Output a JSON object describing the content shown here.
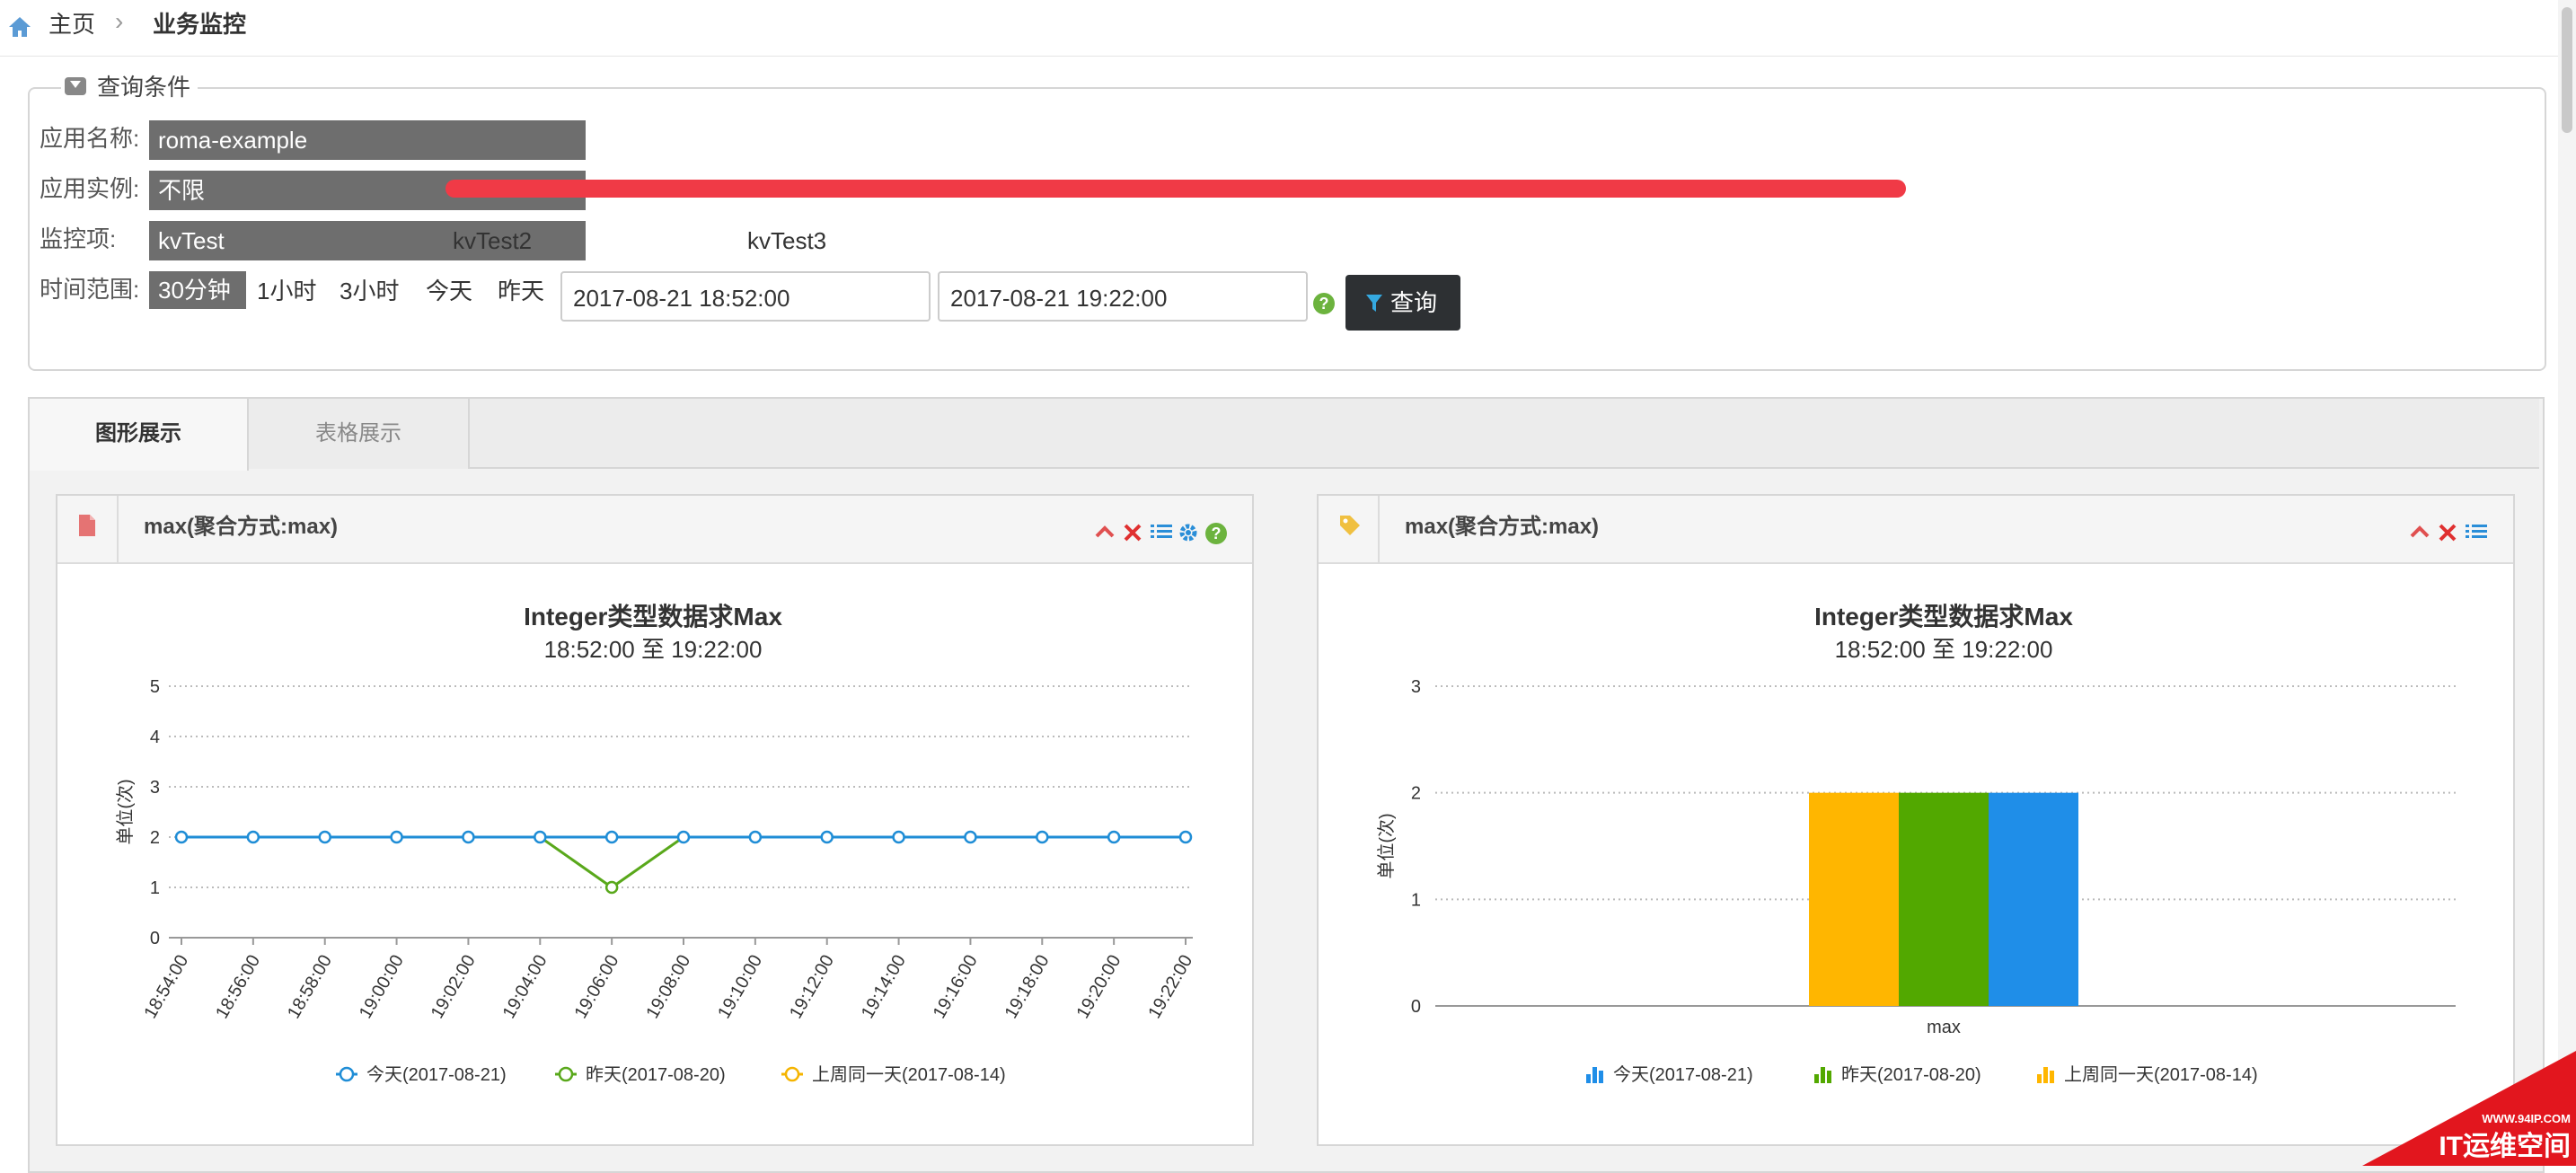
{
  "breadcrumb": {
    "home": "主页",
    "separator": "›",
    "current": "业务监控"
  },
  "query": {
    "legend": "查询条件",
    "app_name_label": "应用名称:",
    "app_name_value": "roma-example",
    "instance_label": "应用实例:",
    "instance_value": "不限",
    "monitor_label": "监控项:",
    "monitor_items": [
      "kvTest",
      "kvTest2",
      "kvTest3"
    ],
    "time_label": "时间范围:",
    "time_options": [
      "30分钟",
      "1小时",
      "3小时",
      "今天",
      "昨天"
    ],
    "start_time": "2017-08-21 18:52:00",
    "end_time": "2017-08-21 19:22:00",
    "help": "?",
    "query_button": "查询"
  },
  "tabs": [
    "图形展示",
    "表格展示"
  ],
  "cards": [
    {
      "title": "max(聚合方式:max)",
      "icon": "file-icon"
    },
    {
      "title": "max(聚合方式:max)",
      "icon": "tag-icon"
    }
  ],
  "colors": {
    "today": "#1f8dd6",
    "yesterday": "#59a81b",
    "last_week": "#f5b400",
    "bar_today": "#1f8ee8",
    "bar_yesterday": "#52a800",
    "bar_last_week": "#ffb600",
    "redaction": "#f03a46"
  },
  "chart_data": [
    {
      "type": "line",
      "title": "Integer类型数据求Max",
      "subtitle": "18:52:00 至 19:22:00",
      "ylabel": "单位(次)",
      "ylim": [
        0,
        5
      ],
      "yticks": [
        0,
        1,
        2,
        3,
        4,
        5
      ],
      "grid": true,
      "legend_position": "bottom",
      "categories": [
        "18:54:00",
        "18:56:00",
        "18:58:00",
        "19:00:00",
        "19:02:00",
        "19:04:00",
        "19:06:00",
        "19:08:00",
        "19:10:00",
        "19:12:00",
        "19:14:00",
        "19:16:00",
        "19:18:00",
        "19:20:00",
        "19:22:00"
      ],
      "series": [
        {
          "name": "今天(2017-08-21)",
          "values": [
            2,
            2,
            2,
            2,
            2,
            2,
            2,
            2,
            2,
            2,
            2,
            2,
            2,
            2,
            2
          ]
        },
        {
          "name": "昨天(2017-08-20)",
          "values": [
            2,
            2,
            2,
            2,
            2,
            2,
            1,
            2,
            2,
            2,
            2,
            2,
            2,
            2,
            2
          ]
        },
        {
          "name": "上周同一天(2017-08-14)",
          "values": []
        }
      ]
    },
    {
      "type": "bar",
      "title": "Integer类型数据求Max",
      "subtitle": "18:52:00 至 19:22:00",
      "ylabel": "单位(次)",
      "ylim": [
        0,
        3
      ],
      "yticks": [
        0,
        1,
        2,
        3
      ],
      "grid": true,
      "legend_position": "bottom",
      "categories": [
        "max"
      ],
      "series": [
        {
          "name": "今天(2017-08-21)",
          "values": [
            2
          ]
        },
        {
          "name": "昨天(2017-08-20)",
          "values": [
            2
          ]
        },
        {
          "name": "上周同一天(2017-08-14)",
          "values": [
            2
          ]
        }
      ]
    }
  ],
  "watermark": {
    "url": "WWW.94IP.COM",
    "text": "IT运维空间"
  }
}
